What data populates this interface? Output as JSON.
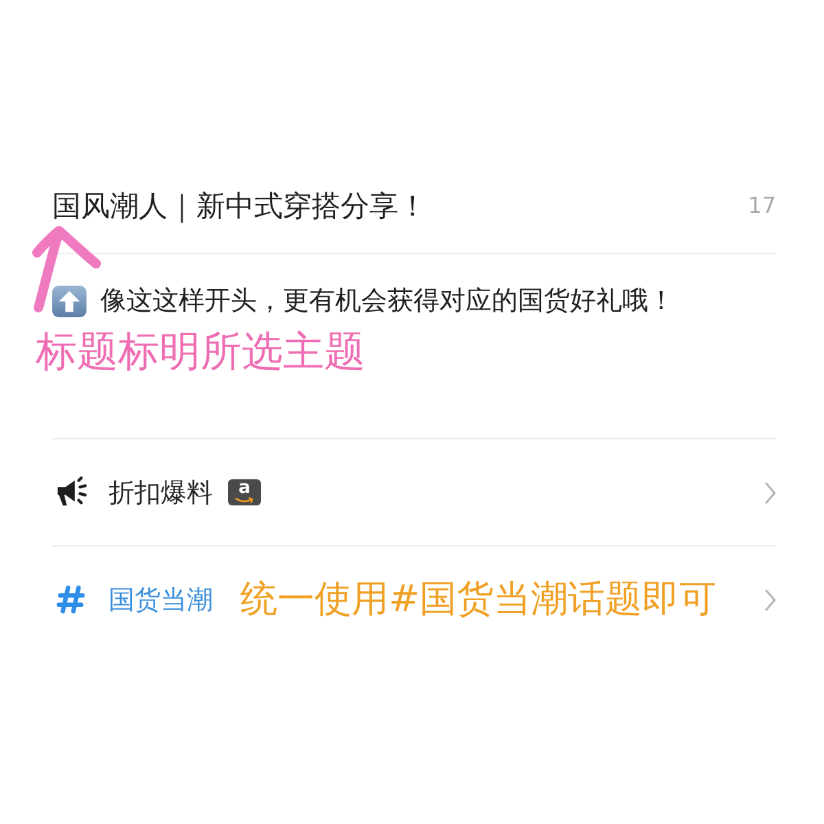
{
  "post": {
    "title": "国风潮人｜新中式穿搭分享！",
    "title_count": "17",
    "body": "像这这样开头，更有机会获得对应的国货好礼哦！",
    "title_note": "标题标明所选主题"
  },
  "rows": [
    {
      "kind": "category",
      "label": "折扣爆料",
      "badge": "a"
    },
    {
      "kind": "topic",
      "label": "国货当潮",
      "note": "统一使用#国货当潮话题即可"
    }
  ]
}
